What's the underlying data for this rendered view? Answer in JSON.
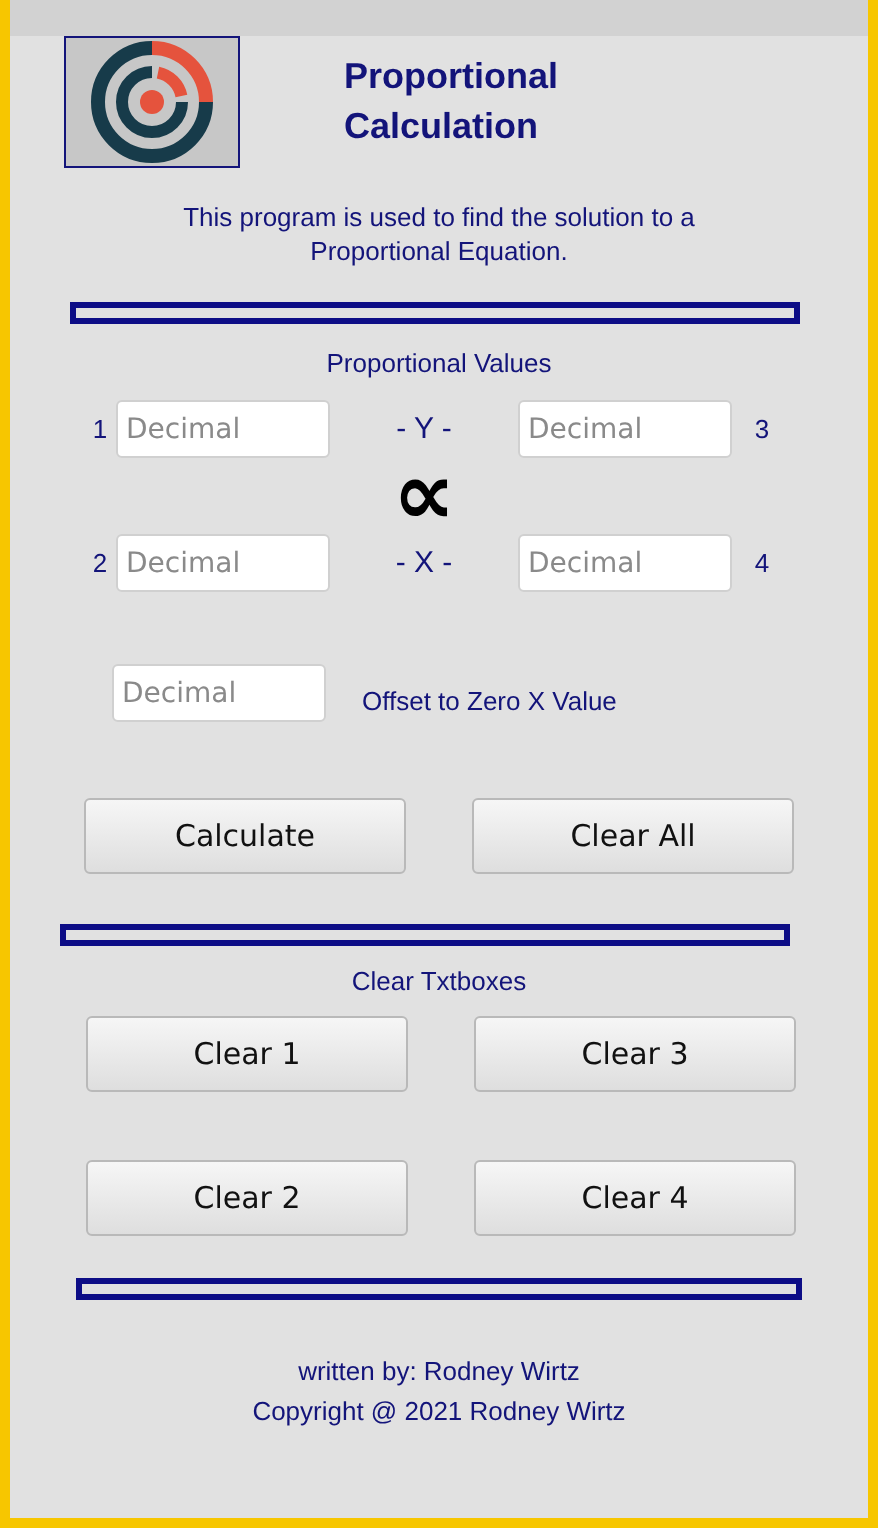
{
  "header": {
    "title": "Proportional Calculation",
    "description": "This program is used to find the solution to a Proportional Equation."
  },
  "values_section": {
    "title": "Proportional Values",
    "symbol": "∝",
    "y_label": "- Y -",
    "x_label": "- X -",
    "fields": [
      {
        "label": "1",
        "placeholder": "Decimal"
      },
      {
        "label": "3",
        "placeholder": "Decimal"
      },
      {
        "label": "2",
        "placeholder": "Decimal"
      },
      {
        "label": "4",
        "placeholder": "Decimal"
      }
    ],
    "offset": {
      "placeholder": "Decimal",
      "label": "Offset to Zero X Value"
    }
  },
  "actions": [
    "Calculate",
    "Clear All"
  ],
  "clear_section": {
    "title": "Clear Txtboxes",
    "buttons": [
      "Clear 1",
      "Clear 3",
      "Clear 2",
      "Clear 4"
    ]
  },
  "footer": [
    "written by: Rodney Wirtz",
    "Copyright @ 2021 Rodney Wirtz"
  ]
}
